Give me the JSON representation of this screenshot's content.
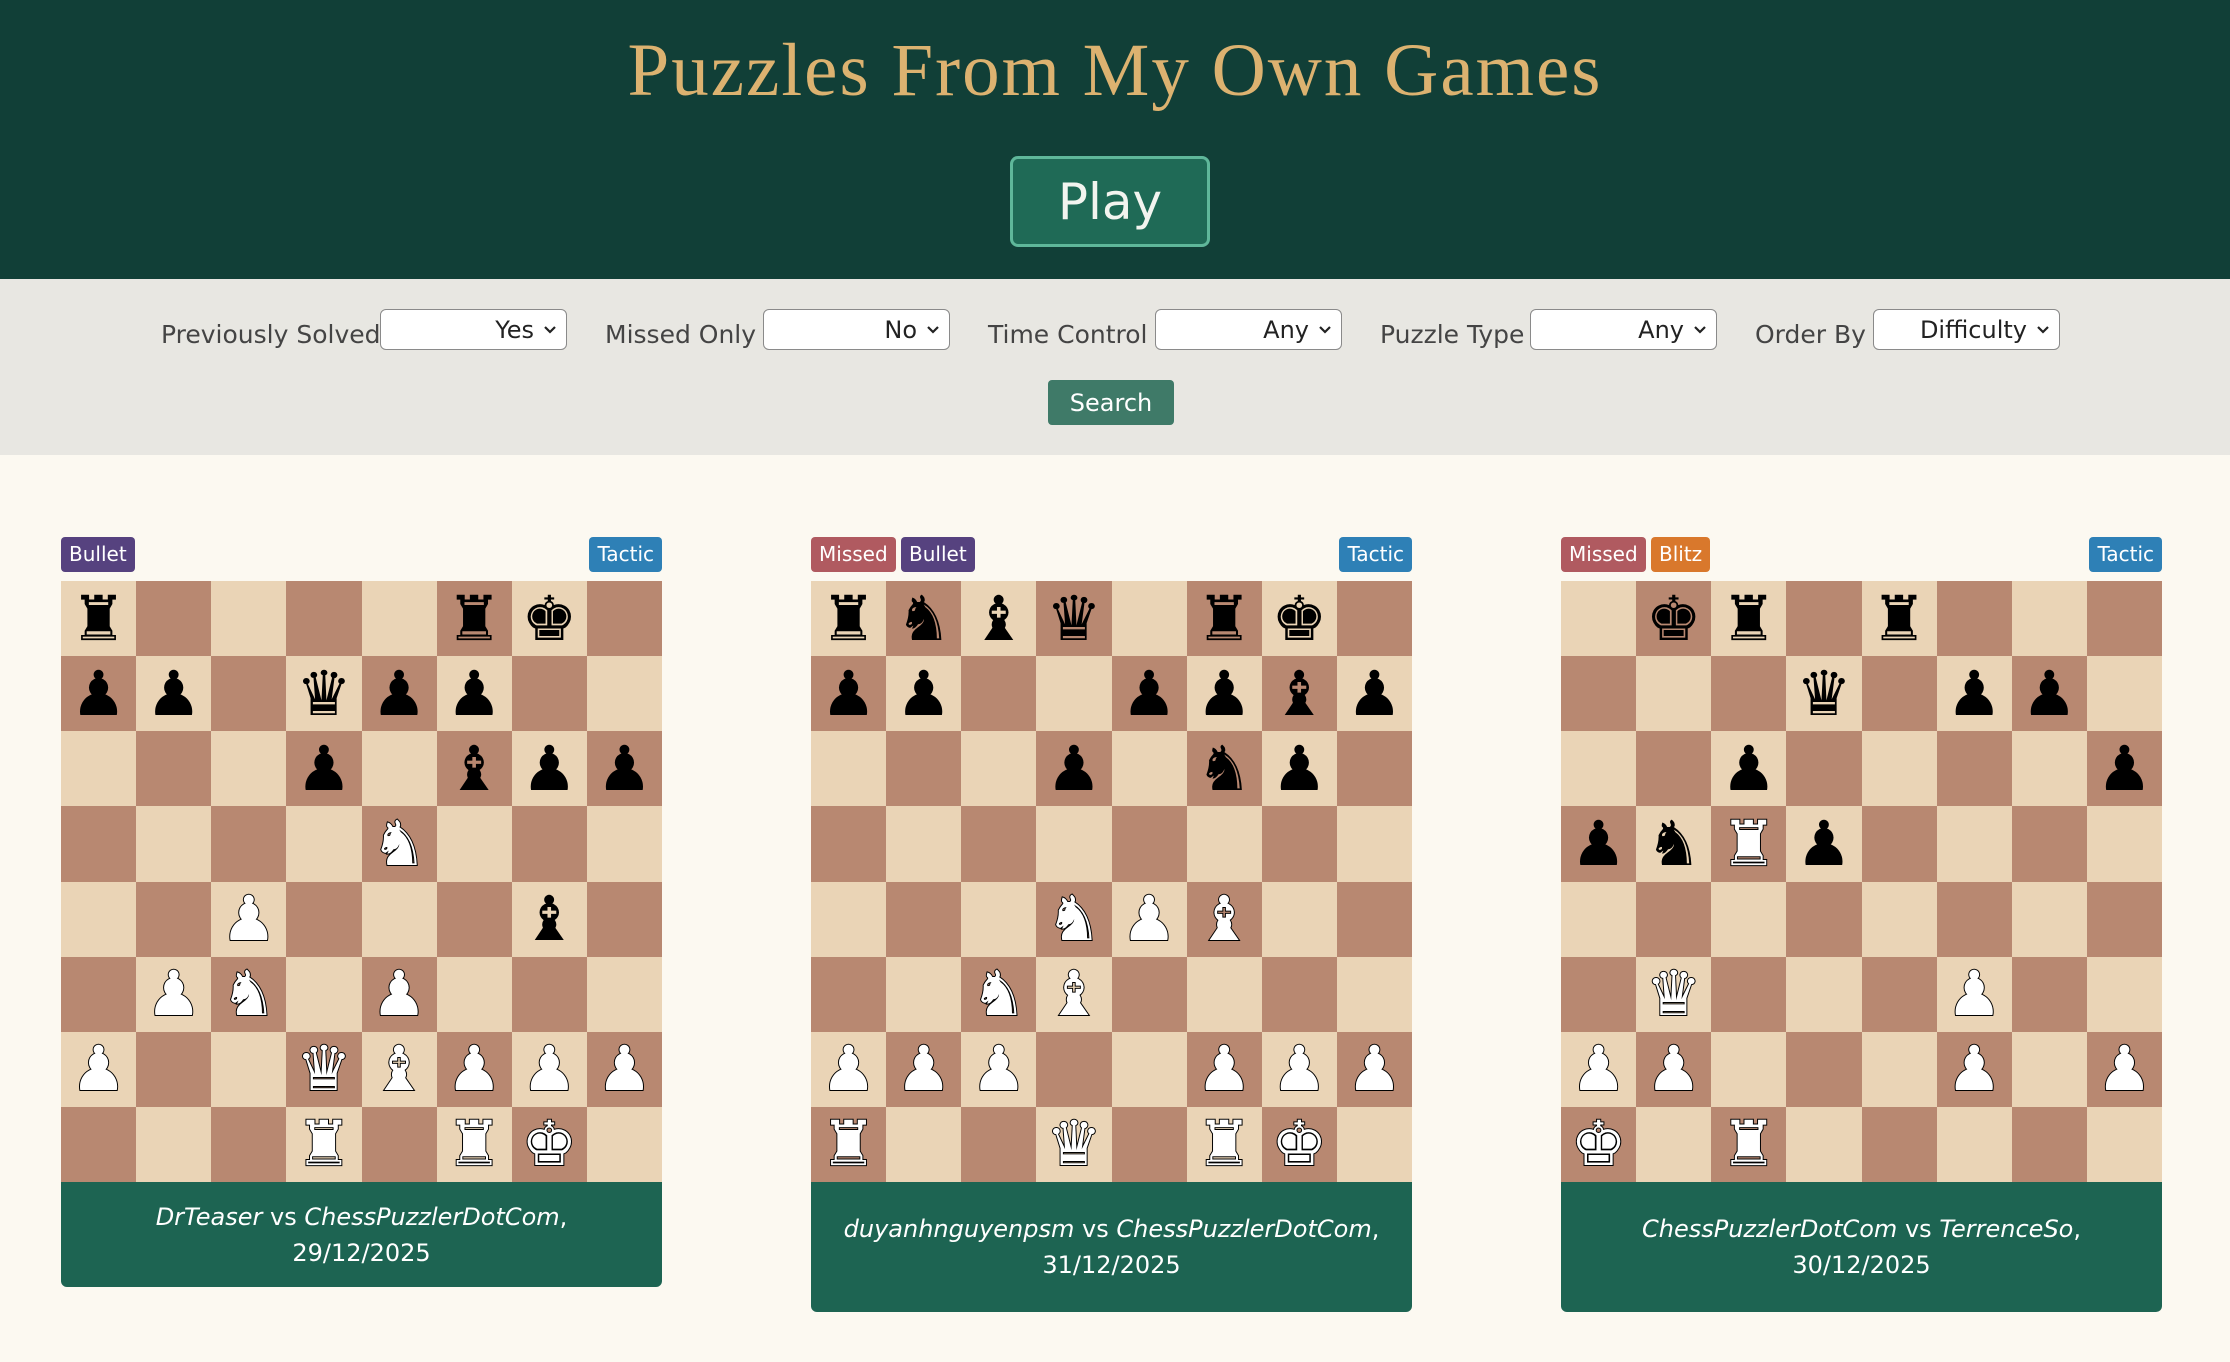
{
  "header": {
    "title": "Puzzles From My Own Games",
    "play_label": "Play"
  },
  "filters": {
    "items": [
      {
        "label": "Previously Solved",
        "value": "Yes"
      },
      {
        "label": "Missed Only",
        "value": "No"
      },
      {
        "label": "Time Control",
        "value": "Any"
      },
      {
        "label": "Puzzle Type",
        "value": "Any"
      },
      {
        "label": "Order By",
        "value": "Difficulty"
      }
    ],
    "search_label": "Search"
  },
  "colors": {
    "header_bg": "#113f37",
    "title": "#dcb270",
    "light_square": "#ead4b6",
    "dark_square": "#b88871",
    "badge_missed": "#b05a60",
    "badge_bullet": "#56427f",
    "badge_blitz": "#d9782c",
    "badge_tactic": "#2e80b6",
    "caption_bg": "#1d6452"
  },
  "puzzles": [
    {
      "badges_left": [
        {
          "text": "Bullet",
          "kind": "bullet"
        }
      ],
      "badge_right": {
        "text": "Tactic",
        "kind": "tactic"
      },
      "board": [
        "r....rk.",
        "pp.qpp..",
        "...p.bpp",
        "....N...",
        "..P...b.",
        ".PN.P...",
        "P..QBPPP",
        "...R.RK."
      ],
      "player1": "DrTeaser",
      "vs": "vs",
      "player2": "ChessPuzzlerDotCom",
      "date": "29/12/2025"
    },
    {
      "badges_left": [
        {
          "text": "Missed",
          "kind": "missed"
        },
        {
          "text": "Bullet",
          "kind": "bullet"
        }
      ],
      "badge_right": {
        "text": "Tactic",
        "kind": "tactic"
      },
      "board": [
        "rnbq.rk.",
        "pp..ppbp",
        "...p.np.",
        "........",
        "...NPB..",
        "..NB....",
        "PPP..PPP",
        "R..Q.RK."
      ],
      "player1": "duyanhnguyenpsm",
      "vs": "vs",
      "player2": "ChessPuzzlerDotCom",
      "date": "31/12/2025"
    },
    {
      "badges_left": [
        {
          "text": "Missed",
          "kind": "missed"
        },
        {
          "text": "Blitz",
          "kind": "blitz"
        }
      ],
      "badge_right": {
        "text": "Tactic",
        "kind": "tactic"
      },
      "board": [
        ".kr.r...",
        "...q.pp.",
        "..p....p",
        "pnRp....",
        "........",
        ".Q...P..",
        "PP...P.P",
        "K.R....."
      ],
      "player1": "ChessPuzzlerDotCom",
      "vs": "vs",
      "player2": "TerrenceSo",
      "date": "30/12/2025"
    }
  ]
}
